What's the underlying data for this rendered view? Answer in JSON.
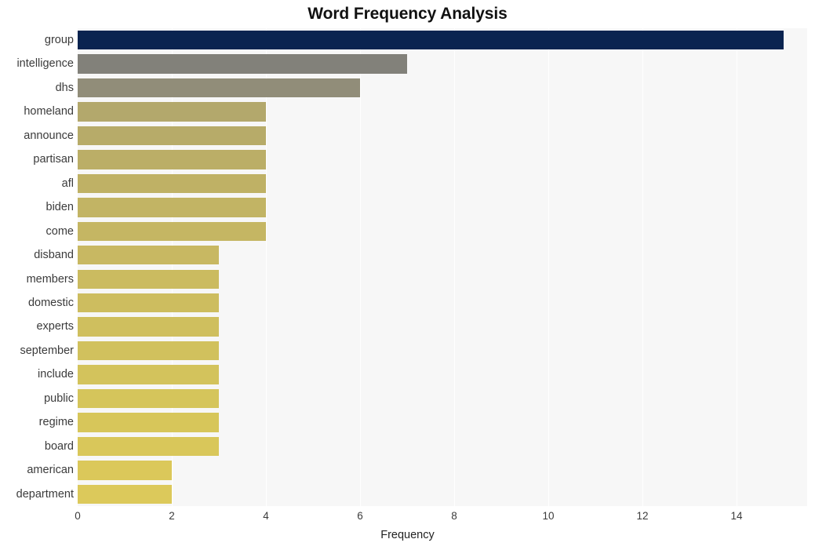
{
  "chart_data": {
    "type": "bar",
    "orientation": "horizontal",
    "title": "Word Frequency Analysis",
    "xlabel": "Frequency",
    "ylabel": "",
    "xlim": [
      0,
      15.5
    ],
    "xticks": [
      0,
      2,
      4,
      6,
      8,
      10,
      12,
      14
    ],
    "xtick_labels": [
      "0",
      "2",
      "4",
      "6",
      "8",
      "10",
      "12",
      "14"
    ],
    "grid": true,
    "grid_color": "#ffffff",
    "plot_background": "#f7f7f7",
    "legend": null,
    "categories": [
      "group",
      "intelligence",
      "dhs",
      "homeland",
      "announce",
      "partisan",
      "afl",
      "biden",
      "come",
      "disband",
      "members",
      "domestic",
      "experts",
      "september",
      "include",
      "public",
      "regime",
      "board",
      "american",
      "department"
    ],
    "values": [
      15,
      7,
      6,
      4,
      4,
      4,
      4,
      4,
      4,
      3,
      3,
      3,
      3,
      3,
      3,
      3,
      3,
      3,
      2,
      2
    ],
    "bar_colors": [
      "#0a2450",
      "#82817a",
      "#918d79",
      "#b3a86c",
      "#b7ab69",
      "#bbae67",
      "#bfb165",
      "#c2b464",
      "#c5b663",
      "#c8b862",
      "#cbbb60",
      "#cdbd5f",
      "#cfbf5e",
      "#d1c15d",
      "#d3c35c",
      "#d5c55b",
      "#d7c65a",
      "#d9c75a",
      "#dbc85a",
      "#dcc95b"
    ]
  }
}
